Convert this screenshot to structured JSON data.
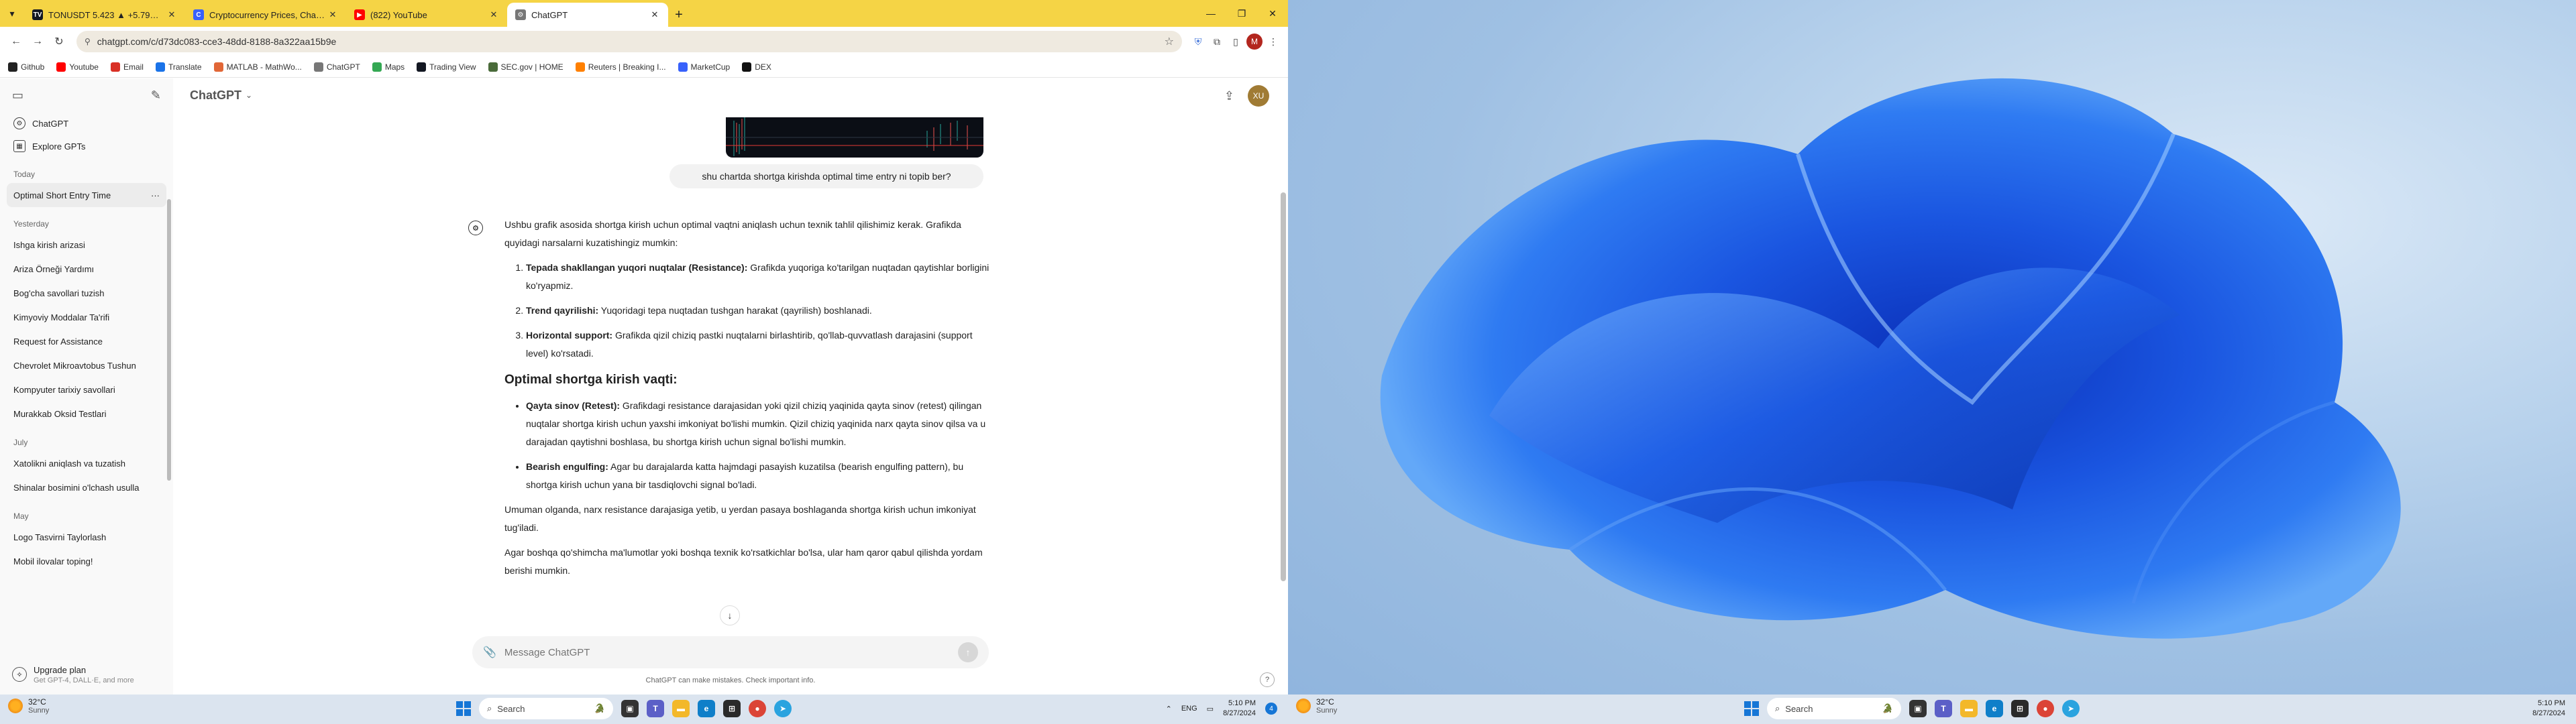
{
  "browser": {
    "tabs": [
      {
        "title": "TONUSDT 5.423 ▲ +5.79% Bes",
        "fav_color": "#131722",
        "fav_text": "TV"
      },
      {
        "title": "Cryptocurrency Prices, Charts A",
        "fav_color": "#3861fb",
        "fav_text": "C"
      },
      {
        "title": "(822) YouTube",
        "fav_color": "#ff0000",
        "fav_text": "▶"
      },
      {
        "title": "ChatGPT",
        "fav_color": "#777777",
        "fav_text": "⚙",
        "active": true
      }
    ],
    "new_tab": "+",
    "url": "chatgpt.com/c/d73dc083-cce3-48dd-8188-8a322aa15b9e"
  },
  "bookmarks": [
    {
      "label": "Github",
      "color": "#222222",
      "icon": "github-icon"
    },
    {
      "label": "Youtube",
      "color": "#ff0000",
      "icon": "youtube-icon"
    },
    {
      "label": "Email",
      "color": "#d93025",
      "icon": "email-icon"
    },
    {
      "label": "Translate",
      "color": "#1a73e8",
      "icon": "translate-icon"
    },
    {
      "label": "MATLAB - MathWo...",
      "color": "#e16737",
      "icon": "matlab-icon"
    },
    {
      "label": "ChatGPT",
      "color": "#777777",
      "icon": "chatgpt-icon"
    },
    {
      "label": "Maps",
      "color": "#34a853",
      "icon": "maps-icon"
    },
    {
      "label": "Trading View",
      "color": "#131722",
      "icon": "tradingview-icon"
    },
    {
      "label": "SEC.gov | HOME",
      "color": "#4a6b3a",
      "icon": "sec-icon"
    },
    {
      "label": "Reuters | Breaking I...",
      "color": "#ff8000",
      "icon": "reuters-icon"
    },
    {
      "label": "MarketCup",
      "color": "#3861fb",
      "icon": "marketcap-icon"
    },
    {
      "label": "DEX",
      "color": "#111111",
      "icon": "dex-icon"
    }
  ],
  "sidebar": {
    "nav": [
      {
        "label": "ChatGPT",
        "icon": "chatgpt-icon"
      },
      {
        "label": "Explore GPTs",
        "icon": "grid-icon"
      }
    ],
    "sections": [
      {
        "title": "Today",
        "items": [
          "Optimal Short Entry Time"
        ]
      },
      {
        "title": "Yesterday",
        "items": [
          "Ishga kirish arizasi",
          "Ariza Örneği Yardımı",
          "Bog'cha savollari tuzish",
          "Kimyoviy Moddalar Ta'rifi",
          "Request for Assistance",
          "Chevrolet Mikroavtobus Tushun",
          "Kompyuter tarixiy savollari",
          "Murakkab Oksid Testlari"
        ]
      },
      {
        "title": "July",
        "items": [
          "Xatolikni aniqlash va tuzatish",
          "Shinalar bosimini o'lchash usulla"
        ]
      },
      {
        "title": "May",
        "items": [
          "Logo Tasvirni Taylorlash",
          "Mobil ilovalar toping!"
        ]
      }
    ],
    "upgrade_title": "Upgrade plan",
    "upgrade_sub": "Get GPT-4, DALL·E, and more"
  },
  "chat": {
    "model": "ChatGPT",
    "user_initials": "XU",
    "user_message": "shu chartda shortga kirishda optimal time entry ni topib ber?",
    "intro": "Ushbu grafik asosida shortga kirish uchun optimal vaqtni aniqlash uchun texnik tahlil qilishimiz kerak. Grafikda quyidagi narsalarni kuzatishingiz mumkin:",
    "points": [
      {
        "bold": "Tepada shakllangan yuqori nuqtalar (Resistance):",
        "text": " Grafikda yuqoriga ko'tarilgan nuqtadan qaytishlar borligini ko'ryapmiz."
      },
      {
        "bold": "Trend qayrilishi:",
        "text": " Yuqoridagi tepa nuqtadan tushgan harakat (qayrilish) boshlanadi."
      },
      {
        "bold": "Horizontal support:",
        "text": " Grafikda qizil chiziq pastki nuqtalarni birlashtirib, qo'llab-quvvatlash darajasini (support level) ko'rsatadi."
      }
    ],
    "heading": "Optimal shortga kirish vaqti:",
    "bullets": [
      {
        "bold": "Qayta sinov (Retest):",
        "text": " Grafikdagi resistance darajasidan yoki qizil chiziq yaqinida qayta sinov (retest) qilingan nuqtalar shortga kirish uchun yaxshi imkoniyat bo'lishi mumkin. Qizil chiziq yaqinida narx qayta sinov qilsa va u darajadan qaytishni boshlasa, bu shortga kirish uchun signal bo'lishi mumkin."
      },
      {
        "bold": "Bearish engulfing:",
        "text": " Agar bu darajalarda katta hajmdagi pasayish kuzatilsa (bearish engulfing pattern), bu shortga kirish uchun yana bir tasdiqlovchi signal bo'ladi."
      }
    ],
    "summary": "Umuman olganda, narx resistance darajasiga yetib, u yerdan pasaya boshlaganda shortga kirish uchun imkoniyat tug'iladi.",
    "closing": "Agar boshqa qo'shimcha ma'lumotlar yoki boshqa texnik ko'rsatkichlar bo'lsa, ular ham qaror qabul qilishda yordam berishi mumkin.",
    "composer_placeholder": "Message ChatGPT",
    "disclaimer": "ChatGPT can make mistakes. Check important info.",
    "help": "?"
  },
  "taskbar": {
    "temp": "32°C",
    "condition": "Sunny",
    "search": "Search",
    "lang": "ENG",
    "time": "5:10 PM",
    "date": "8/27/2024",
    "notif_count": "4"
  }
}
